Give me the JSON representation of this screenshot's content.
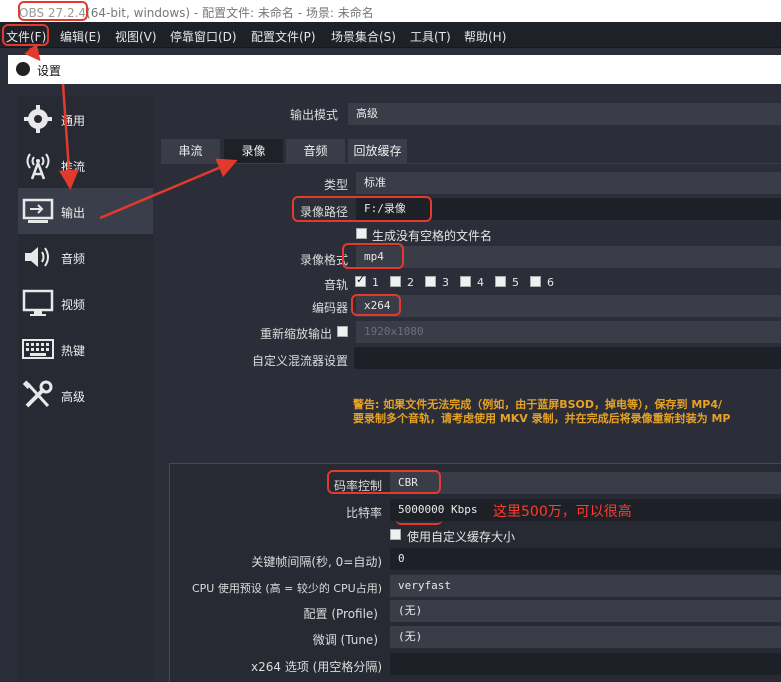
{
  "window": {
    "title_prefix": "OBS 27.2.4",
    "title_rest": "(64-bit, windows) - 配置文件: 未命名 - 场景: 未命名"
  },
  "menubar": {
    "items": [
      "文件(F)",
      "编辑(E)",
      "视图(V)",
      "停靠窗口(D)",
      "配置文件(P)",
      "场景集合(S)",
      "工具(T)",
      "帮助(H)"
    ]
  },
  "dialog": {
    "title": "设置"
  },
  "sidebar": {
    "items": [
      {
        "label": "通用",
        "icon": "gear-icon"
      },
      {
        "label": "推流",
        "icon": "antenna-icon"
      },
      {
        "label": "输出",
        "icon": "output-icon"
      },
      {
        "label": "音频",
        "icon": "speaker-icon"
      },
      {
        "label": "视频",
        "icon": "monitor-icon"
      },
      {
        "label": "热键",
        "icon": "keyboard-icon"
      },
      {
        "label": "高级",
        "icon": "tools-icon"
      }
    ],
    "active": "输出"
  },
  "output": {
    "mode_label": "输出模式",
    "mode_value": "高级",
    "tabs": [
      "串流",
      "录像",
      "音频",
      "回放缓存"
    ],
    "active_tab": "录像",
    "type_label": "类型",
    "type_value": "标准",
    "path_label": "录像路径",
    "path_value": "F:/录像",
    "nospace_label": "生成没有空格的文件名",
    "format_label": "录像格式",
    "format_value": "mp4",
    "tracks_label": "音轨",
    "tracks": [
      "1",
      "2",
      "3",
      "4",
      "5",
      "6"
    ],
    "encoder_label": "编码器",
    "encoder_value": "x264",
    "rescale_label": "重新缩放输出",
    "rescale_value": "1920x1080",
    "muxer_label": "自定义混流器设置",
    "muxer_value": "",
    "warning_line1": "警告: 如果文件无法完成（例如，由于蓝屏BSOD，掉电等），保存到 MP4/",
    "warning_line2": "要录制多个音轨，请考虑使用 MKV 录制，并在完成后将录像重新封装为 MP"
  },
  "encoder_settings": {
    "rate_control_label": "码率控制",
    "rate_control_value": "CBR",
    "bitrate_label": "比特率",
    "bitrate_value": "5000000",
    "bitrate_unit": "Kbps",
    "custom_buffer_label": "使用自定义缓存大小",
    "keyframe_label": "关键帧间隔(秒, 0=自动)",
    "keyframe_value": "0",
    "cpu_preset_label": "CPU 使用预设 (高 = 较少的 CPU占用)",
    "cpu_preset_value": "veryfast",
    "profile_label": "配置 (Profile)",
    "profile_value": "(无)",
    "tune_label": "微调 (Tune)",
    "tune_value": "(无)",
    "x264_opts_label": "x264 选项 (用空格分隔)",
    "x264_opts_value": ""
  },
  "annotation": {
    "text": "这里500万，可以很高"
  },
  "colors": {
    "accent_red": "#e23a2c",
    "warning": "#e6a226",
    "bg": "#2b2e38"
  }
}
